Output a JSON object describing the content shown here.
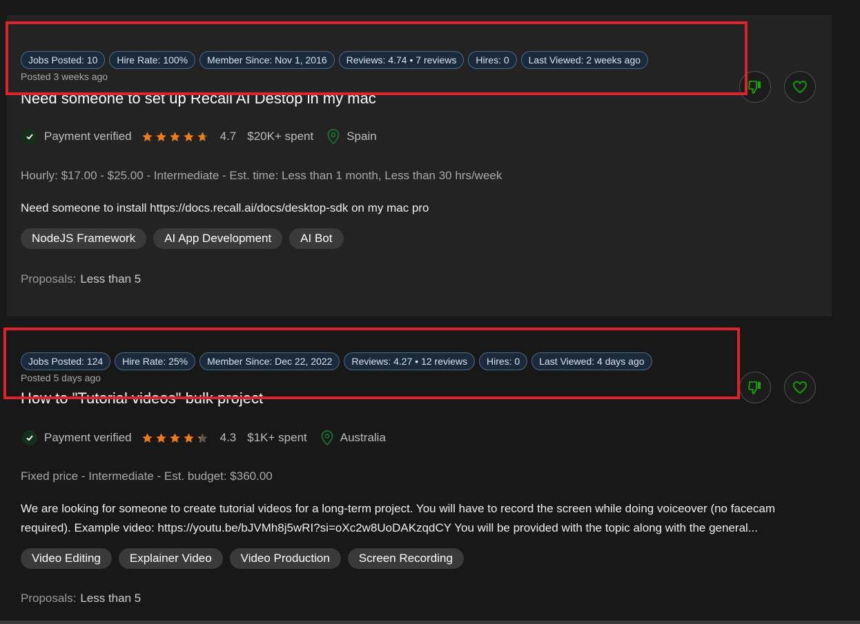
{
  "jobs": [
    {
      "stats": [
        "Jobs Posted: 10",
        "Hire Rate: 100%",
        "Member Since: Nov 1, 2016",
        "Reviews: 4.74 • 7 reviews",
        "Hires: 0",
        "Last Viewed: 2 weeks ago"
      ],
      "posted": "Posted 3 weeks ago",
      "title": "Need someone to set up Recall AI Destop in my mac",
      "payment": "Payment verified",
      "rating": "4.7",
      "rating_value": 4.7,
      "spent": "$20K+ spent",
      "location": "Spain",
      "info": "Hourly: $17.00 - $25.00 - Intermediate - Est. time: Less than 1 month, Less than 30 hrs/week",
      "description": "Need someone to install https://docs.recall.ai/docs/desktop-sdk on my mac pro",
      "skills": [
        "NodeJS Framework",
        "AI App Development",
        "AI Bot"
      ],
      "proposals_label": "Proposals:",
      "proposals_value": "Less than 5"
    },
    {
      "stats": [
        "Jobs Posted: 124",
        "Hire Rate: 25%",
        "Member Since: Dec 22, 2022",
        "Reviews: 4.27 • 12 reviews",
        "Hires: 0",
        "Last Viewed: 4 days ago"
      ],
      "posted": "Posted 5 days ago",
      "title": "How to \"Tutorial videos\" bulk project",
      "payment": "Payment verified",
      "rating": "4.3",
      "rating_value": 4.3,
      "spent": "$1K+ spent",
      "location": "Australia",
      "info": "Fixed price - Intermediate - Est. budget: $360.00",
      "description": "We are looking for someone to create tutorial videos for a long-term project. You will have to record the screen while doing voiceover (no facecam required). Example video: https://youtu.be/bJVMh8j5wRI?si=oXc2w8UoDAKzqdCY You will be provided with the topic along with the general...",
      "skills": [
        "Video Editing",
        "Explainer Video",
        "Video Production",
        "Screen Recording"
      ],
      "proposals_label": "Proposals:",
      "proposals_value": "Less than 5"
    }
  ],
  "icons": {
    "dislike": "thumbs-down-icon",
    "save": "heart-icon",
    "verified": "check-icon",
    "location": "map-pin-icon",
    "rating": "star-icon"
  },
  "colors": {
    "star": "#f07b14",
    "accent_green": "#14a800",
    "highlight_box": "#e0232b",
    "pill_border": "#4a6a90"
  }
}
